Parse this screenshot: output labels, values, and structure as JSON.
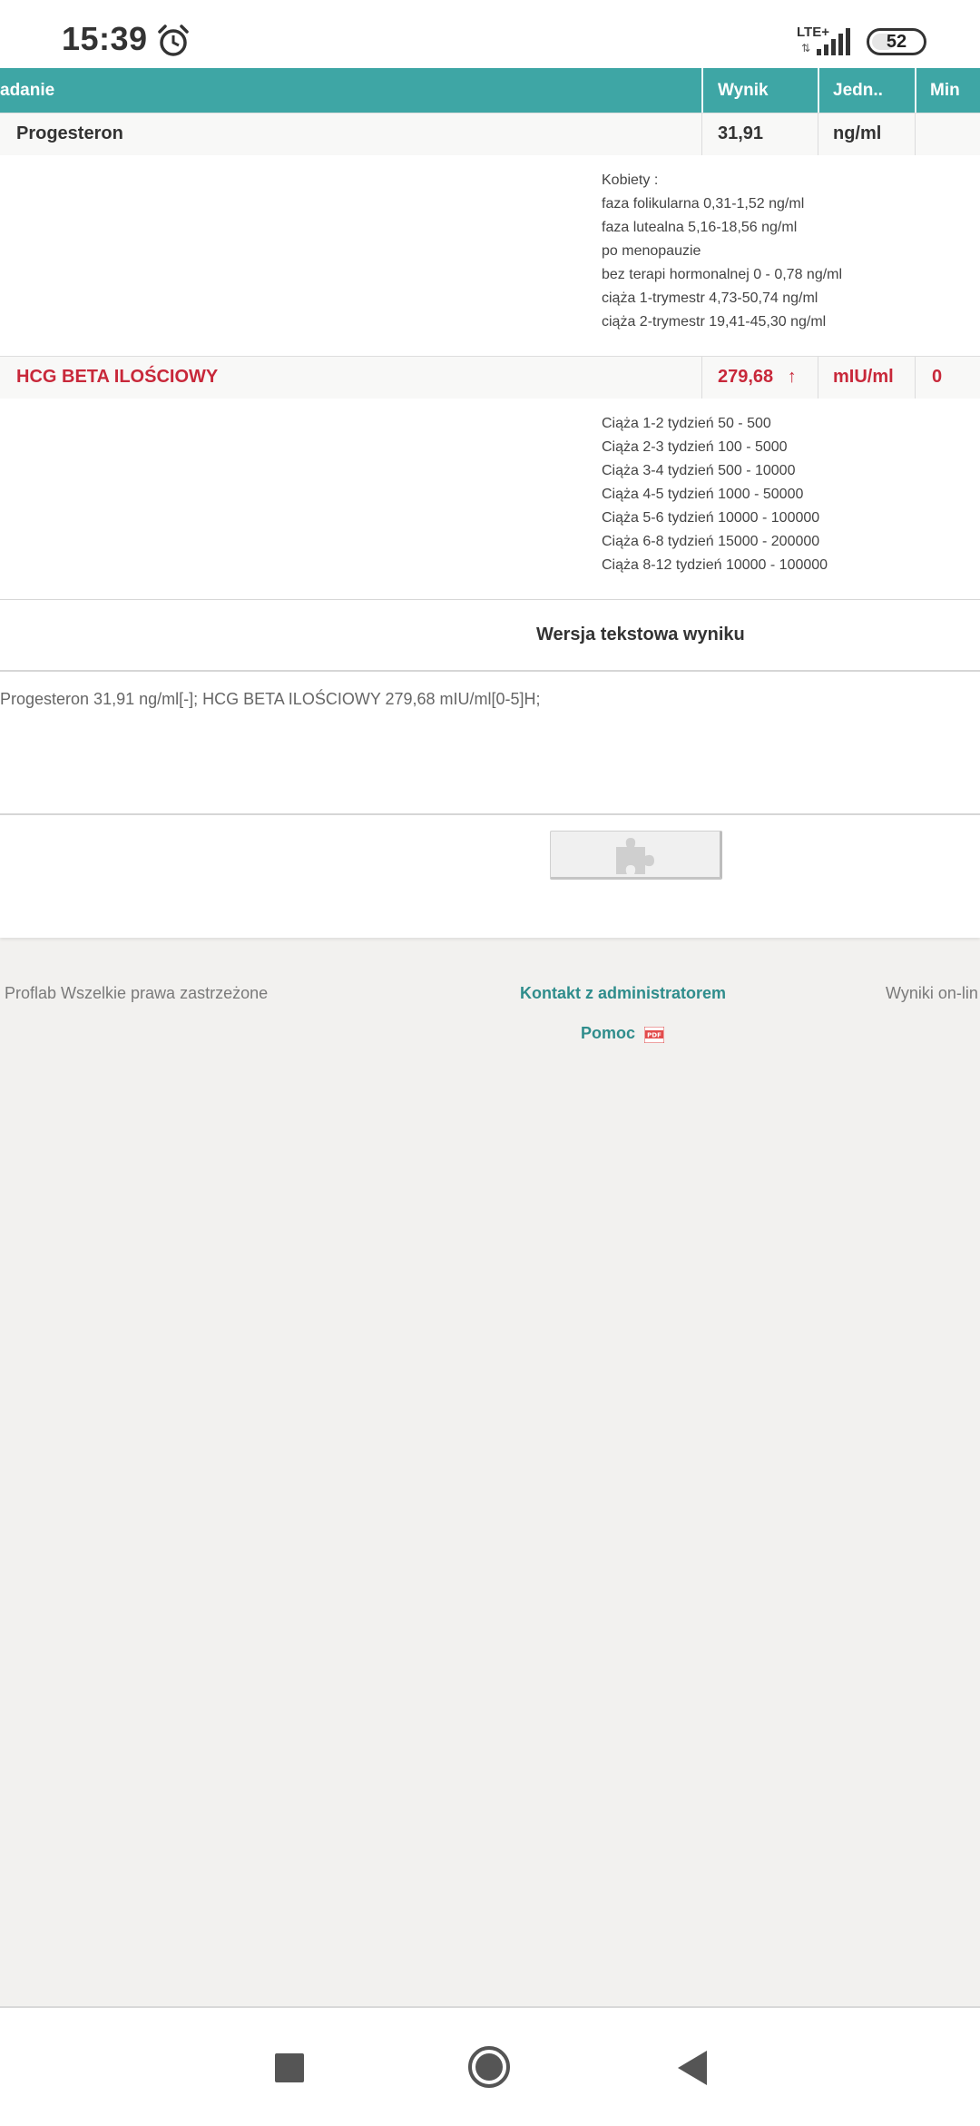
{
  "status_bar": {
    "time": "15:39",
    "network": "LTE+",
    "data_arrows": "⇅",
    "battery": "52",
    "battery_level": 0.52,
    "icons": [
      "alarm-icon",
      "signal-icon",
      "battery-icon"
    ]
  },
  "table": {
    "headers": [
      "adanie",
      "Wynik",
      "Jedn..",
      "Min"
    ],
    "rows": [
      {
        "name": "Progesteron",
        "result": "31,91",
        "unit": "ng/ml",
        "min": "",
        "reference": [
          "Kobiety :",
          "faza folikularna 0,31-1,52 ng/ml",
          "faza lutealna 5,16-18,56 ng/ml",
          "po menopauzie",
          "bez terapi hormonalnej 0 - 0,78 ng/ml",
          "ciąża 1-trymestr 4,73-50,74 ng/ml",
          "ciąża 2-trymestr 19,41-45,30 ng/ml"
        ]
      },
      {
        "name": "HCG BETA ILOŚCIOWY",
        "result": "279,68",
        "flag": "↑",
        "unit": "mIU/ml",
        "min": "0",
        "reference": [
          "Ciąża 1-2 tydzień 50 - 500",
          "Ciąża 2-3 tydzień 100 - 5000",
          "Ciąża 3-4 tydzień 500 - 10000",
          "Ciąża 4-5 tydzień 1000 - 50000",
          "Ciąża 5-6 tydzień 10000 - 100000",
          "Ciąża 6-8 tydzień 15000 - 200000",
          "Ciąża 8-12 tydzień 10000 - 100000"
        ]
      }
    ]
  },
  "text_version": {
    "title": "Wersja tekstowa wyniku",
    "content": "Progesteron 31,91 ng/ml[-]; HCG BETA ILOŚCIOWY 279,68 mIU/ml[0-5]H;"
  },
  "footer": {
    "copyright": "Proflab Wszelkie prawa zastrzeżone",
    "contact": "Kontakt z administratorem",
    "results_online": "Wyniki on-lin",
    "help": "Pomoc",
    "pdf_badge": "PDF"
  },
  "colors": {
    "header_teal": "#3ea6a5",
    "alert_red": "#c8283a",
    "link_teal": "#2f8d8c"
  }
}
